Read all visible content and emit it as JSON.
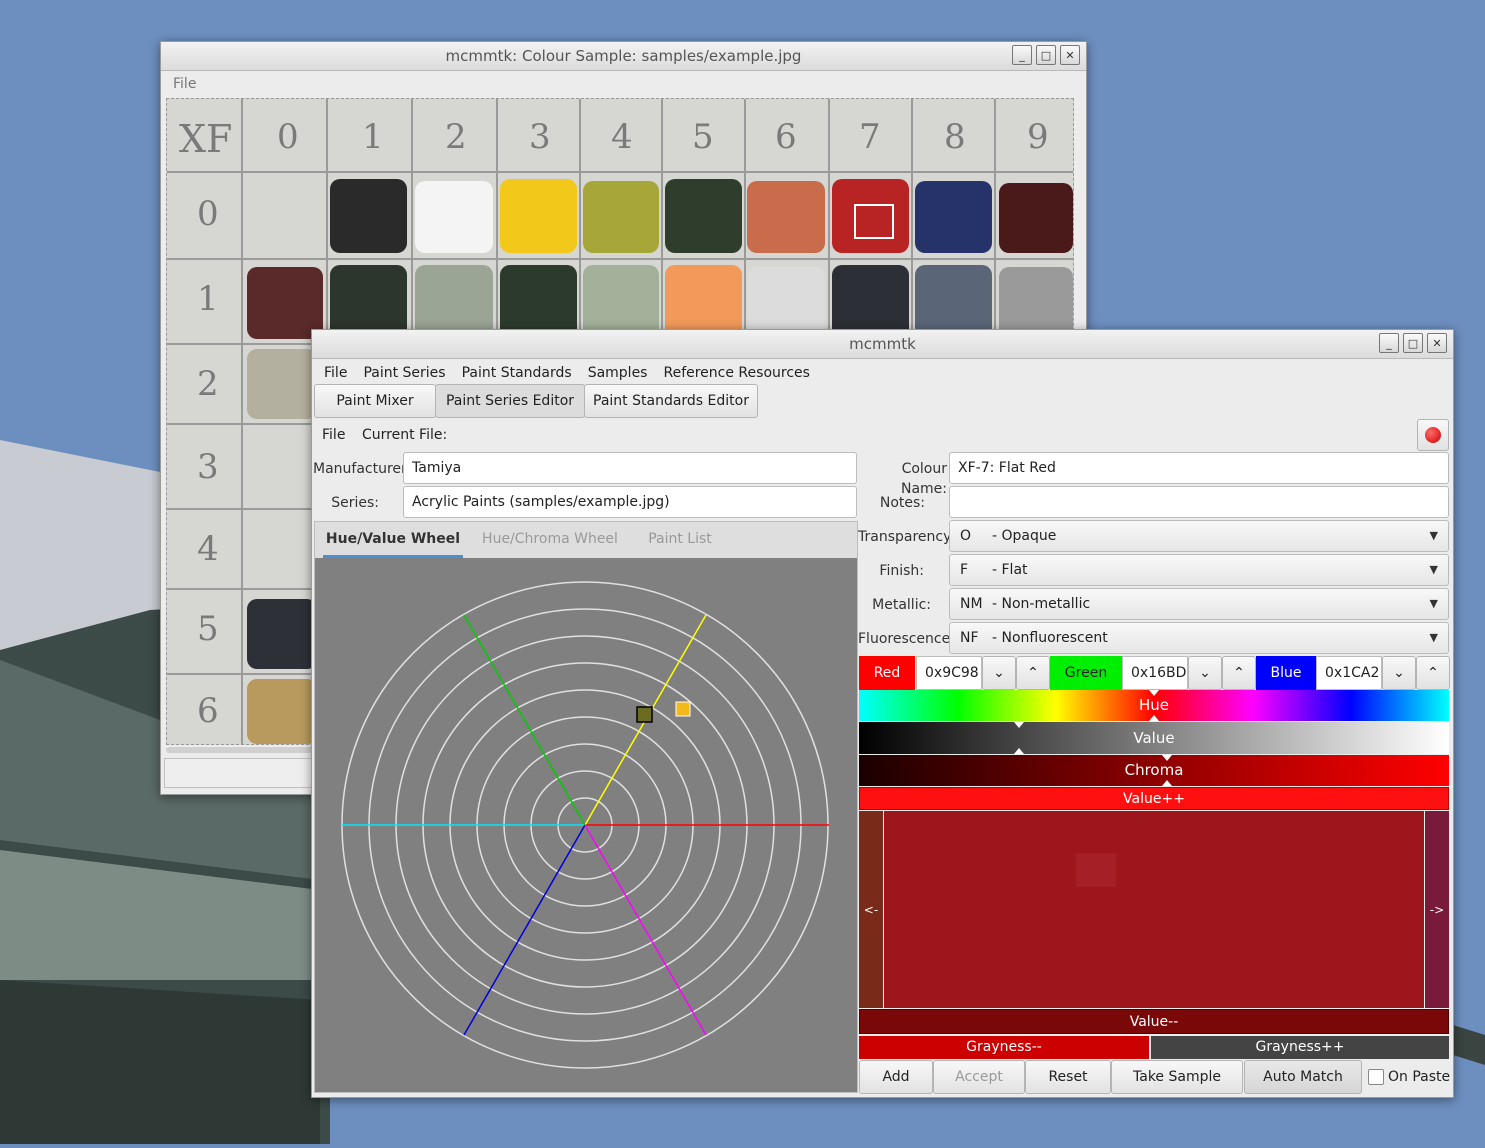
{
  "sample_window": {
    "title": "mcmmtk: Colour Sample: samples/example.jpg",
    "menu": [
      "File"
    ],
    "row_headers": [
      "0",
      "1",
      "2",
      "3",
      "4",
      "5",
      "6"
    ],
    "col_headers": [
      "XF",
      "0",
      "1",
      "2",
      "3",
      "4",
      "5",
      "6",
      "7",
      "8",
      "9"
    ]
  },
  "main_window": {
    "title": "mcmmtk",
    "menu": [
      "File",
      "Paint Series",
      "Paint Standards",
      "Samples",
      "Reference Resources"
    ],
    "tabs": [
      "Paint Mixer",
      "Paint Series Editor",
      "Paint Standards Editor"
    ],
    "file_menu": "File",
    "current_file_label": "Current File:",
    "manufacturer_label": "Manufacturer:",
    "manufacturer_value": "Tamiya",
    "series_label": "Series:",
    "series_value": "Acrylic Paints (samples/example.jpg)",
    "view_tabs": [
      "Hue/Value Wheel",
      "Hue/Chroma Wheel",
      "Paint List"
    ],
    "colour_name_label": "Colour Name:",
    "colour_name_value": "XF-7: Flat Red",
    "notes_label": "Notes:",
    "notes_value": "",
    "transparency_label": "Transparency:",
    "transparency_code": "O",
    "transparency_value": "- Opaque",
    "finish_label": "Finish:",
    "finish_code": "F",
    "finish_value": "- Flat",
    "metallic_label": "Metallic:",
    "metallic_code": "NM",
    "metallic_value": "- Non-metallic",
    "fluorescence_label": "Fluorescence:",
    "fluorescence_code": "NF",
    "fluorescence_value": "- Nonfluorescent",
    "red_label": "Red",
    "red_value": "0x9C98",
    "green_label": "Green",
    "green_value": "0x16BD",
    "blue_label": "Blue",
    "blue_value": "0x1CA2",
    "hue_label": "Hue",
    "value_label": "Value",
    "chroma_label": "Chroma",
    "value_up_label": "Value++",
    "value_down_label": "Value--",
    "left_label": "<-",
    "right_label": "->",
    "grayness_down_label": "Grayness--",
    "grayness_up_label": "Grayness++",
    "buttons": [
      "Add",
      "Accept",
      "Reset",
      "Take Sample",
      "Auto Match"
    ],
    "on_paste_label": "On Paste",
    "on_paste_checked": false
  },
  "colors": {
    "current_colour": "#9c161c",
    "sample_swatches_row0": [
      "#2a2a2a",
      "#f4f4f4",
      "#f2c91a",
      "#a7a638",
      "#2f3e2c",
      "#c96c4c",
      "#b82424",
      "#26336a",
      "#4a1a1a"
    ],
    "sample_swatches_row1": [
      "#5a2a2a",
      "#2c362c",
      "#9aa595",
      "#2c3a2c",
      "#a3b19a",
      "#f29a5a",
      "#dcdcdc",
      "#2c2f36",
      "#5a6678",
      "#9a9a9a"
    ]
  },
  "wheel_points": [
    {
      "name": "sample",
      "colour": "#6b6b22"
    },
    {
      "name": "current",
      "colour": "#f2b91a"
    }
  ]
}
